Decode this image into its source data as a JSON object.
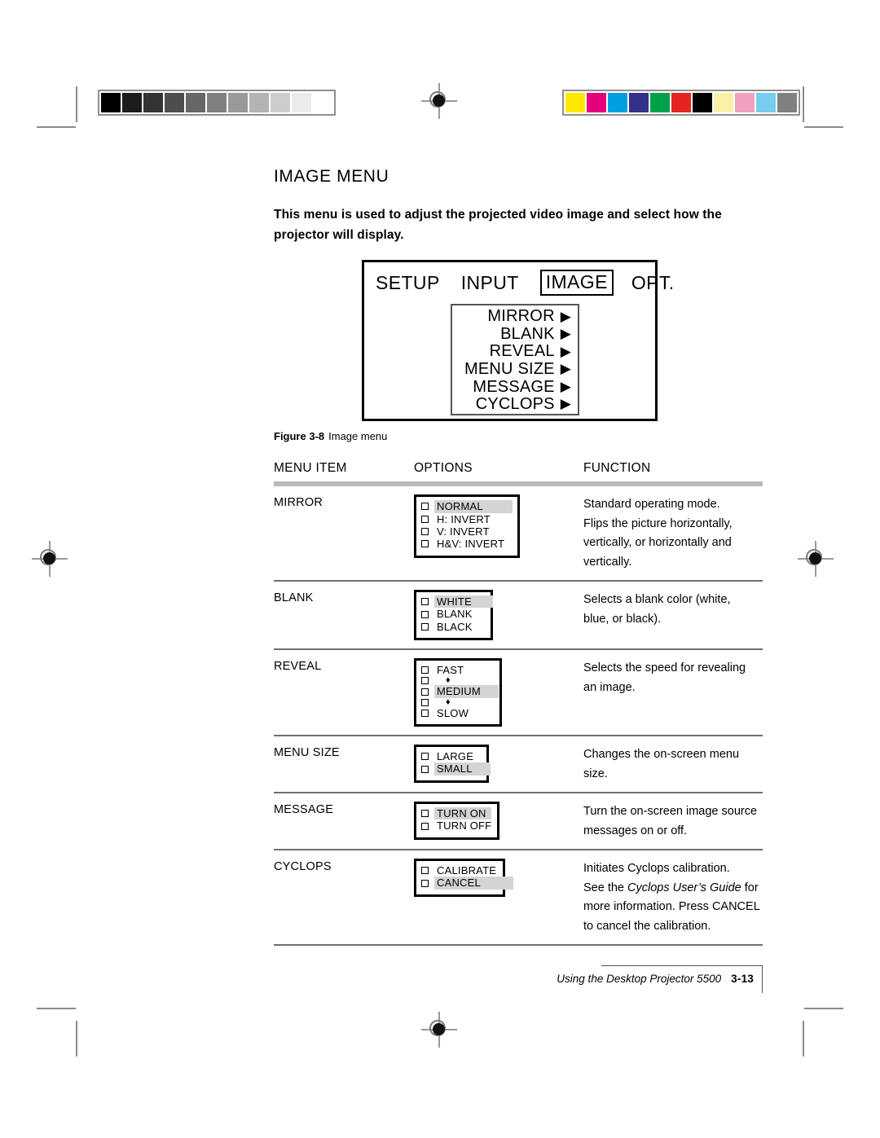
{
  "page": {
    "title": "IMAGE MENU",
    "intro": "This menu is used to adjust the projected video image and select how the projector will display."
  },
  "osd": {
    "tabs": [
      {
        "label": "SETUP",
        "selected": false
      },
      {
        "label": "INPUT",
        "selected": false
      },
      {
        "label": "IMAGE",
        "selected": true
      },
      {
        "label": "OPT.",
        "selected": false
      }
    ],
    "items": [
      {
        "label": "MIRROR",
        "arrow": "▶"
      },
      {
        "label": "BLANK",
        "arrow": "▶"
      },
      {
        "label": "REVEAL",
        "arrow": "▶"
      },
      {
        "label": "MENU SIZE",
        "arrow": "▶"
      },
      {
        "label": "MESSAGE",
        "arrow": "▶"
      },
      {
        "label": "CYCLOPS",
        "arrow": "▶"
      }
    ]
  },
  "figure": {
    "label": "Figure 3-8",
    "text": "Image menu"
  },
  "table": {
    "headers": {
      "item": "MENU ITEM",
      "options": "OPTIONS",
      "function": "FUNCTION"
    },
    "rows": [
      {
        "item": "MIRROR",
        "options": [
          {
            "label": "NORMAL",
            "highlighted": true,
            "glyph": false
          },
          {
            "label": "H: INVERT",
            "highlighted": false,
            "glyph": false
          },
          {
            "label": "V: INVERT",
            "highlighted": false,
            "glyph": false
          },
          {
            "label": "H&V: INVERT",
            "highlighted": false,
            "glyph": false
          }
        ],
        "function_lines": [
          "Standard operating mode.",
          "Flips the picture horizontally,",
          "vertically, or horizontally and",
          "vertically."
        ]
      },
      {
        "item": "BLANK",
        "options": [
          {
            "label": "WHITE",
            "highlighted": true,
            "glyph": false
          },
          {
            "label": "BLANK",
            "highlighted": false,
            "glyph": false
          },
          {
            "label": "BLACK",
            "highlighted": false,
            "glyph": false
          }
        ],
        "function_lines": [
          "Selects a blank color (white,",
          "blue, or black)."
        ]
      },
      {
        "item": "REVEAL",
        "options": [
          {
            "label": "FAST",
            "highlighted": false,
            "glyph": false
          },
          {
            "label": "♦",
            "highlighted": false,
            "glyph": true
          },
          {
            "label": "MEDIUM",
            "highlighted": true,
            "glyph": false
          },
          {
            "label": "♦",
            "highlighted": false,
            "glyph": true
          },
          {
            "label": "SLOW",
            "highlighted": false,
            "glyph": false
          }
        ],
        "function_lines": [
          "Selects the speed for revealing",
          "an image."
        ]
      },
      {
        "item": "MENU SIZE",
        "options": [
          {
            "label": "LARGE",
            "highlighted": false,
            "glyph": false
          },
          {
            "label": "SMALL",
            "highlighted": true,
            "glyph": false
          }
        ],
        "function_lines": [
          "Changes the on-screen menu",
          "size."
        ]
      },
      {
        "item": "MESSAGE",
        "options": [
          {
            "label": "TURN ON",
            "highlighted": true,
            "glyph": false
          },
          {
            "label": "TURN OFF",
            "highlighted": false,
            "glyph": false
          }
        ],
        "function_lines": [
          "Turn the on-screen image source",
          "messages on or off."
        ]
      },
      {
        "item": "CYCLOPS",
        "options": [
          {
            "label": "CALIBRATE",
            "highlighted": false,
            "glyph": false
          },
          {
            "label": "CANCEL",
            "highlighted": true,
            "glyph": false
          }
        ],
        "function_lines": [
          "Initiates Cyclops calibration.",
          "See the <em>Cyclops User’s Guide</em> for",
          "more information. Press CANCEL",
          "to cancel the calibration."
        ]
      }
    ]
  },
  "footer": {
    "title": "Using the Desktop Projector 5500",
    "page_number": "3-13"
  },
  "print_marks": {
    "grayscale_swatches": [
      "#000000",
      "#1c1c1c",
      "#333333",
      "#4d4d4d",
      "#666666",
      "#808080",
      "#999999",
      "#b3b3b3",
      "#cccccc",
      "#ebebeb",
      "#ffffff"
    ],
    "color_swatches": [
      "#ffe800",
      "#e6007e",
      "#00a0e0",
      "#33318c",
      "#00a04a",
      "#e52420",
      "#000000",
      "#fbf0a8",
      "#f2a0c0",
      "#76cdf0",
      "#808080"
    ]
  }
}
